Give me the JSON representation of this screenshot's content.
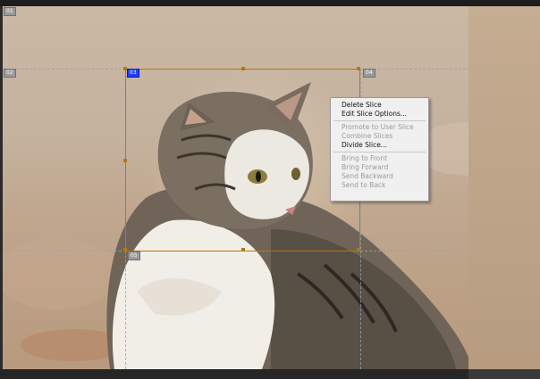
{
  "context_menu": {
    "items": [
      {
        "label": "Delete Slice",
        "enabled": true
      },
      {
        "label": "Edit Slice Options...",
        "enabled": true
      },
      {
        "separator": true
      },
      {
        "label": "Promote to User Slice",
        "enabled": false
      },
      {
        "label": "Combine Slices",
        "enabled": false
      },
      {
        "label": "Divide Slice...",
        "enabled": true
      },
      {
        "separator": true
      },
      {
        "label": "Bring to Front",
        "enabled": false
      },
      {
        "label": "Bring Forward",
        "enabled": false
      },
      {
        "label": "Send Backward",
        "enabled": false
      },
      {
        "label": "Send to Back",
        "enabled": false
      }
    ]
  },
  "slice_badges": {
    "top_left": "01",
    "upper_row_left": "02",
    "selected": "03",
    "upper_row_right": "04",
    "lower_row_left": "05"
  },
  "colors": {
    "slice_line": "#b07a10",
    "guide_line": "#8ea3c8",
    "selected_badge": "#1f3cff"
  }
}
